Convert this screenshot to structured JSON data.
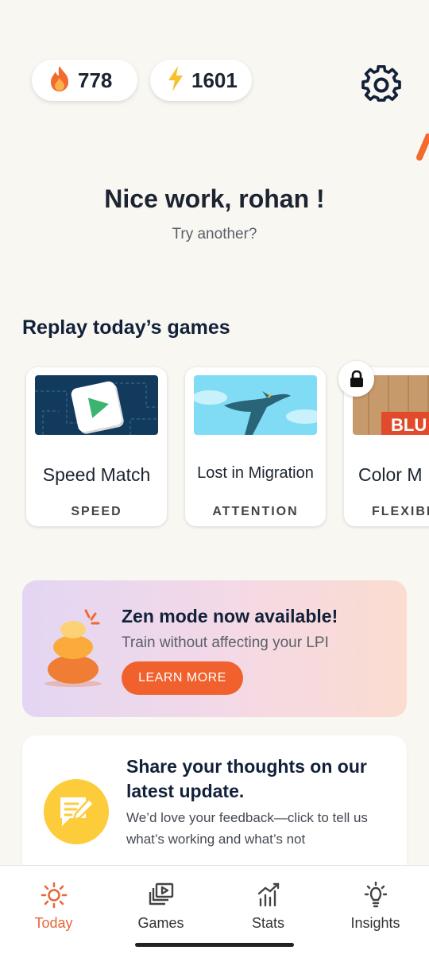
{
  "stats": {
    "streak_value": "778",
    "lpi_value": "1601",
    "streak_icon": "flame-icon",
    "lpi_icon": "lightning-icon"
  },
  "header": {
    "settings_icon": "gear-icon",
    "title": "Nice work, rohan !",
    "subtitle": "Try another?"
  },
  "replay": {
    "section_title": "Replay today’s games",
    "games": [
      {
        "name": "Speed Match",
        "category": "SPEED"
      },
      {
        "name": "Lost in Migration",
        "category": "ATTENTION"
      },
      {
        "name": "Color M",
        "category": "FLEXIBIL",
        "locked": true,
        "art_text": "BLU"
      }
    ]
  },
  "zen_banner": {
    "title": "Zen mode now available!",
    "subtitle": "Train without affecting your LPI",
    "button_label": "LEARN MORE"
  },
  "feedback_card": {
    "title": "Share your thoughts on our latest update.",
    "body": "We’d love your feedback—click to tell us what’s working and what’s not"
  },
  "bottom_nav": {
    "items": [
      {
        "label": "Today",
        "icon": "sun-icon",
        "active": true
      },
      {
        "label": "Games",
        "icon": "games-icon",
        "active": false
      },
      {
        "label": "Stats",
        "icon": "stats-icon",
        "active": false
      },
      {
        "label": "Insights",
        "icon": "lightbulb-icon",
        "active": false
      }
    ]
  },
  "colors": {
    "accent": "#f0612e",
    "background": "#f9f7f2",
    "active_nav": "#e7663a"
  }
}
